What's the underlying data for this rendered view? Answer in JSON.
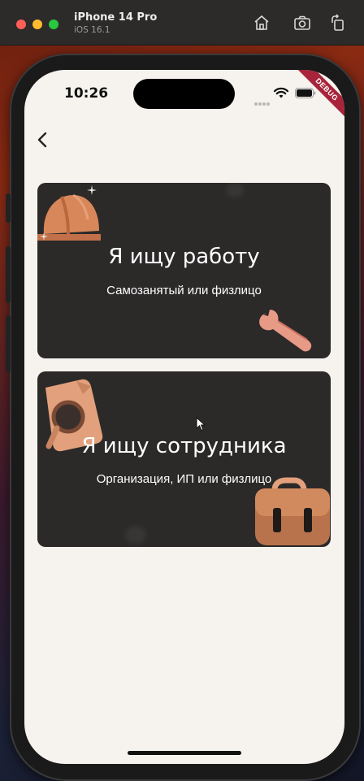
{
  "simulator": {
    "device_name": "iPhone 14 Pro",
    "os_version": "iOS 16.1",
    "icons": [
      "home-icon",
      "screenshot-icon",
      "rotate-icon"
    ]
  },
  "status_bar": {
    "time": "10:26",
    "debug_badge": "DEBUG"
  },
  "nav": {
    "back_icon": "chevron-left-icon"
  },
  "cards": [
    {
      "title": "Я ищу работу",
      "subtitle": "Самозанятый или физлицо",
      "icons": [
        "hard-hat-icon",
        "wrench-icon",
        "sparkle-icon"
      ]
    },
    {
      "title": "Я ищу сотрудника",
      "subtitle": "Организация, ИП или физлицо",
      "icons": [
        "document-magnifier-icon",
        "briefcase-icon"
      ]
    }
  ],
  "colors": {
    "screen_bg": "#f6f3ee",
    "card_bg": "#2c2929",
    "accent": "#d98a5c",
    "debug_banner": "#a8243a"
  }
}
